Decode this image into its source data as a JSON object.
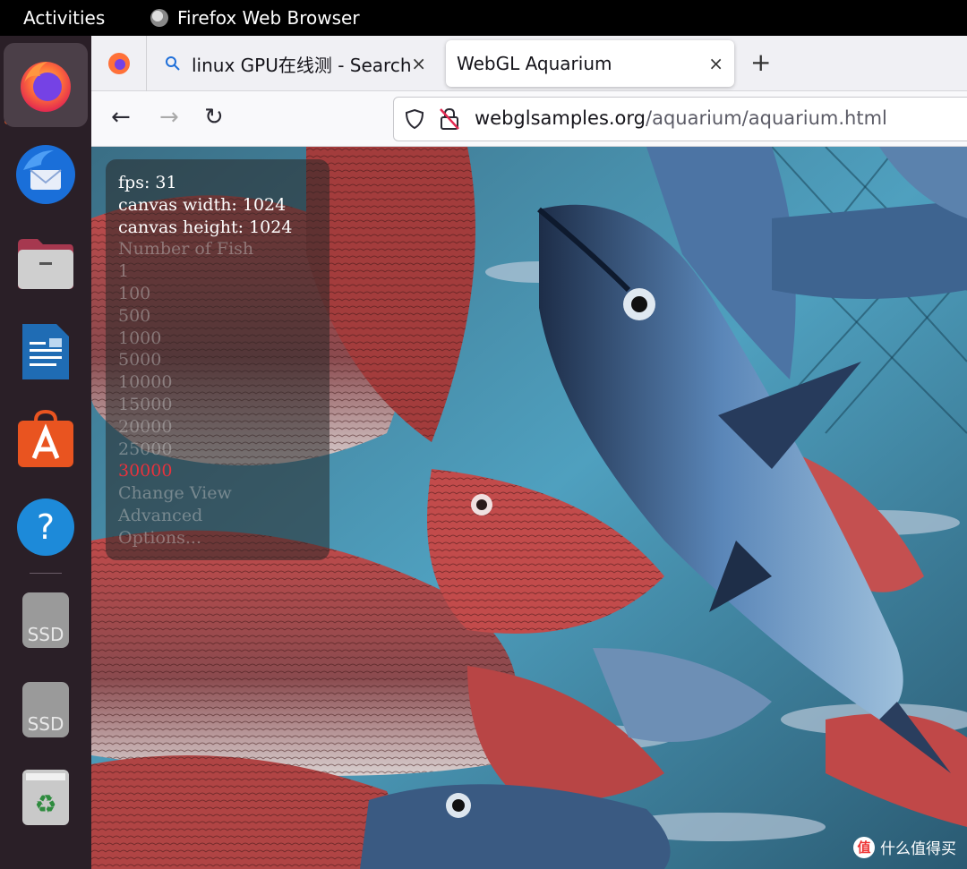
{
  "topbar": {
    "activities": "Activities",
    "app_name": "Firefox Web Browser"
  },
  "dock": {
    "items": [
      {
        "name": "Firefox",
        "icon": "firefox-icon",
        "active": true
      },
      {
        "name": "Thunderbird",
        "icon": "thunderbird-icon"
      },
      {
        "name": "Files",
        "icon": "files-icon"
      },
      {
        "name": "LibreOffice Writer",
        "icon": "writer-icon"
      },
      {
        "name": "Ubuntu Software",
        "icon": "software-icon"
      },
      {
        "name": "Help",
        "icon": "help-icon",
        "glyph": "?"
      },
      {
        "name": "SSD",
        "icon": "drive-icon",
        "label": "SSD"
      },
      {
        "name": "SSD",
        "icon": "drive-icon",
        "label": "SSD"
      },
      {
        "name": "Trash",
        "icon": "trash-icon",
        "glyph": "♻"
      }
    ],
    "accent": "#e95420"
  },
  "browser": {
    "tabs": [
      {
        "title": "linux GPU在线测 - Search",
        "icon": "search-icon",
        "active": false
      },
      {
        "title": "WebGL Aquarium",
        "active": true
      }
    ],
    "close_glyph": "×",
    "new_tab_glyph": "+",
    "url": {
      "host": "webglsamples.org",
      "path": "/aquarium/aquarium.html"
    },
    "nav": {
      "back": "←",
      "forward": "→",
      "reload": "↻"
    }
  },
  "aquarium": {
    "fps": "fps: 31",
    "canvas_width": "canvas width: 1024",
    "canvas_height": "canvas height: 1024",
    "number_of_fish": "Number of Fish",
    "fish_options": [
      "1",
      "100",
      "500",
      "1000",
      "5000",
      "10000",
      "15000",
      "20000",
      "25000",
      "30000"
    ],
    "selected": "30000",
    "change_view": "Change View",
    "advanced": "Advanced",
    "options": "Options..."
  },
  "watermark": {
    "badge": "值",
    "text": "什么值得买"
  }
}
